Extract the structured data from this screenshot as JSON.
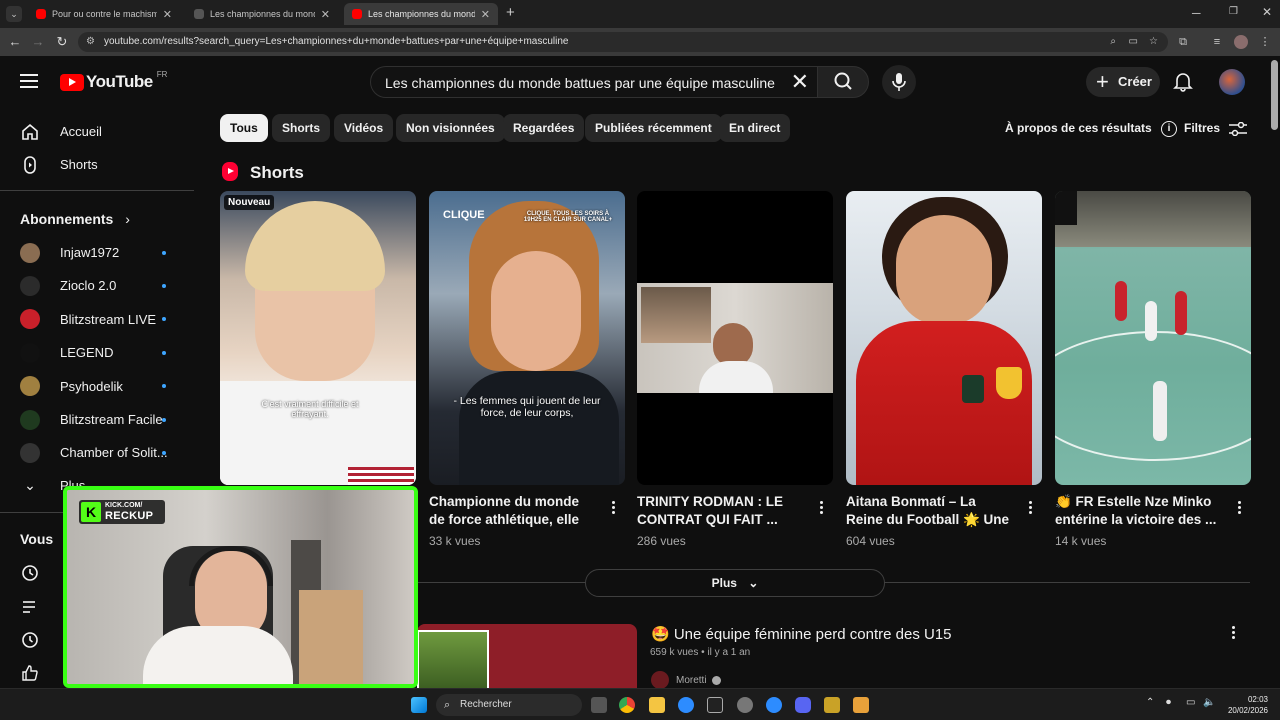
{
  "browser": {
    "tabs": [
      {
        "label": "Pour ou contre le machisme d'A",
        "active": false
      },
      {
        "label": "Les championnes du monde ba",
        "active": false
      },
      {
        "label": "Les championnes du monde ba",
        "active": true
      }
    ],
    "new_tab": "+",
    "url": "youtube.com/results?search_query=Les+championnes+du+monde+battues+par+une+équipe+masculine"
  },
  "header": {
    "logo_text": "YouTube",
    "logo_region": "FR",
    "search_query": "Les championnes du monde battues par une équipe masculine",
    "create_label": "Créer"
  },
  "sidebar": {
    "main": [
      {
        "label": "Accueil",
        "icon": "home-icon"
      },
      {
        "label": "Shorts",
        "icon": "shorts-icon"
      }
    ],
    "subscriptions_title": "Abonnements",
    "subscriptions": [
      {
        "label": "Injaw1972",
        "color": "#8a6d52"
      },
      {
        "label": "Zioclo 2.0",
        "color": "#2b2b2b"
      },
      {
        "label": "Blitzstream LIVE",
        "color": "#c9202a"
      },
      {
        "label": "LEGEND",
        "color": "#111111"
      },
      {
        "label": "Psyhodelik",
        "color": "#a08040"
      },
      {
        "label": "Blitzstream Facile",
        "color": "#1f3a1f"
      },
      {
        "label": "Chamber of Solit...",
        "color": "#333333"
      }
    ],
    "more_label": "Plus",
    "you_title": "Vous"
  },
  "chips": [
    "Tous",
    "Shorts",
    "Vidéos",
    "Non visionnées",
    "Regardées",
    "Publiées récemment",
    "En direct"
  ],
  "about_label": "À propos de ces résultats",
  "filters_label": "Filtres",
  "shorts_section": {
    "title": "Shorts",
    "items": [
      {
        "title": "",
        "views": "",
        "badge": "Nouveau",
        "caption": "C'est vraiment difficile et effrayant."
      },
      {
        "title": "Championne du monde de force athlétique, elle fait ...",
        "views": "33 k vues",
        "caption": "- Les femmes qui jouent de leur force, de leur corps,",
        "overlay": "CLIQUE, TOUS LES SOIRS À 19H25 EN CLAIR SUR CANAL+"
      },
      {
        "title": "TRINITY RODMAN : LE CONTRAT QUI FAIT ...",
        "views": "286 vues"
      },
      {
        "title": "Aitana Bonmatí – La Reine du Football 🌟 Une ...",
        "views": "604 vues"
      },
      {
        "title": "👏 FR Estelle Nze Minko entérine la victoire des ...",
        "views": "14 k vues"
      }
    ],
    "more_label": "Plus"
  },
  "video_result": {
    "title": "🤩 Une équipe féminine perd contre des U15",
    "views": "659 k vues",
    "age": "il y a 1 an",
    "channel": "Moretti"
  },
  "webcam": {
    "brand_line1": "KICK.COM/",
    "brand_line2": "RECKUP"
  },
  "taskbar": {
    "search_placeholder": "Rechercher",
    "time": "02:03",
    "date": "20/02/2026"
  }
}
